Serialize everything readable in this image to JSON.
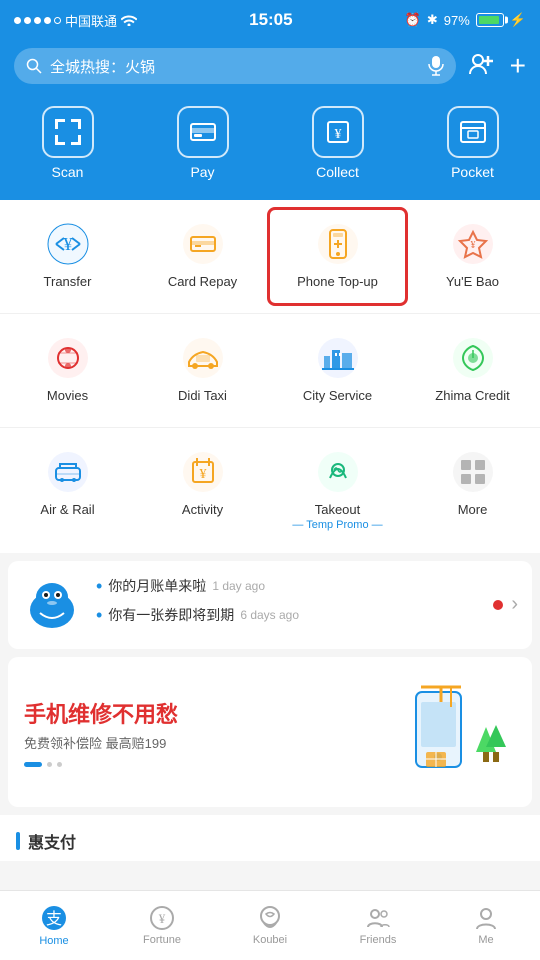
{
  "statusBar": {
    "carrier": "中国联通",
    "time": "15:05",
    "battery": "97%"
  },
  "header": {
    "searchPlaceholder": "全城热搜：火锅"
  },
  "topNav": {
    "items": [
      {
        "id": "scan",
        "label": "Scan"
      },
      {
        "id": "pay",
        "label": "Pay"
      },
      {
        "id": "collect",
        "label": "Collect"
      },
      {
        "id": "pocket",
        "label": "Pocket"
      }
    ]
  },
  "grid": {
    "rows": [
      [
        {
          "id": "transfer",
          "label": "Transfer",
          "sublabel": ""
        },
        {
          "id": "card-repay",
          "label": "Card Repay",
          "sublabel": "",
          "highlighted": false
        },
        {
          "id": "phone-topup",
          "label": "Phone Top-up",
          "sublabel": "",
          "highlighted": true
        },
        {
          "id": "yue-bao",
          "label": "Yu'E Bao",
          "sublabel": ""
        }
      ],
      [
        {
          "id": "movies",
          "label": "Movies",
          "sublabel": ""
        },
        {
          "id": "didi-taxi",
          "label": "Didi Taxi",
          "sublabel": ""
        },
        {
          "id": "city-service",
          "label": "City Service",
          "sublabel": ""
        },
        {
          "id": "zhima-credit",
          "label": "Zhima Credit",
          "sublabel": ""
        }
      ],
      [
        {
          "id": "air-rail",
          "label": "Air & Rail",
          "sublabel": ""
        },
        {
          "id": "activity",
          "label": "Activity",
          "sublabel": ""
        },
        {
          "id": "takeout",
          "label": "Takeout",
          "sublabel": "— Temp Promo —"
        },
        {
          "id": "more",
          "label": "More",
          "sublabel": ""
        }
      ]
    ]
  },
  "feed": {
    "items": [
      {
        "text": "你的月账单来啦",
        "time": "1 day ago"
      },
      {
        "text": "你有一张券即将到期",
        "time": "6 days ago"
      }
    ]
  },
  "banner": {
    "titleBold": "手机维修",
    "titleNormal": "不用愁",
    "subtitle": "免费领补偿险 最高赔199"
  },
  "sectionHeader": "惠支付",
  "bottomNav": {
    "items": [
      {
        "id": "home",
        "label": "Home",
        "active": true
      },
      {
        "id": "fortune",
        "label": "Fortune",
        "active": false
      },
      {
        "id": "koubei",
        "label": "Koubei",
        "active": false
      },
      {
        "id": "friends",
        "label": "Friends",
        "active": false
      },
      {
        "id": "me",
        "label": "Me",
        "active": false
      }
    ]
  },
  "colors": {
    "brand": "#1a8fe3",
    "highlight": "#e03030",
    "orange": "#f5a623",
    "green": "#4cd964"
  }
}
